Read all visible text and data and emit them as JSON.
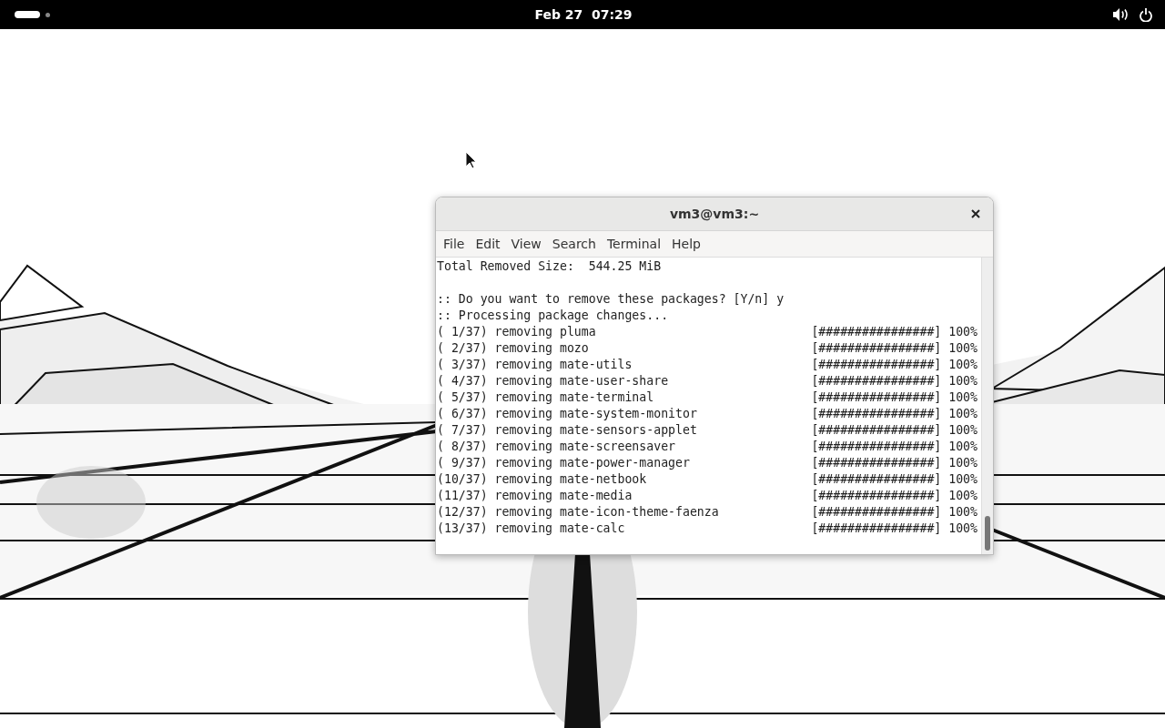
{
  "top_bar": {
    "clock": "Feb 27  07:29"
  },
  "terminal": {
    "title": "vm3@vm3:~",
    "menu": [
      "File",
      "Edit",
      "View",
      "Search",
      "Terminal",
      "Help"
    ],
    "blocks": [
      {
        "lines": [
          {
            "text": "Total Removed Size:  544.25 MiB"
          }
        ]
      },
      {
        "lines": [
          {
            "text": ":: Do you want to remove these packages? [Y/n] y"
          },
          {
            "text": ":: Processing package changes..."
          },
          {
            "text": "( 1/37) removing pluma",
            "progress": "[################] 100%"
          },
          {
            "text": "( 2/37) removing mozo",
            "progress": "[################] 100%"
          },
          {
            "text": "( 3/37) removing mate-utils",
            "progress": "[################] 100%"
          },
          {
            "text": "( 4/37) removing mate-user-share",
            "progress": "[################] 100%"
          },
          {
            "text": "( 5/37) removing mate-terminal",
            "progress": "[################] 100%"
          },
          {
            "text": "( 6/37) removing mate-system-monitor",
            "progress": "[################] 100%"
          },
          {
            "text": "( 7/37) removing mate-sensors-applet",
            "progress": "[################] 100%"
          },
          {
            "text": "( 8/37) removing mate-screensaver",
            "progress": "[################] 100%"
          },
          {
            "text": "( 9/37) removing mate-power-manager",
            "progress": "[################] 100%"
          },
          {
            "text": "(10/37) removing mate-netbook",
            "progress": "[################] 100%"
          },
          {
            "text": "(11/37) removing mate-media",
            "progress": "[################] 100%"
          },
          {
            "text": "(12/37) removing mate-icon-theme-faenza",
            "progress": "[################] 100%"
          },
          {
            "text": "(13/37) removing mate-calc",
            "progress": "[################] 100%"
          }
        ]
      }
    ]
  }
}
